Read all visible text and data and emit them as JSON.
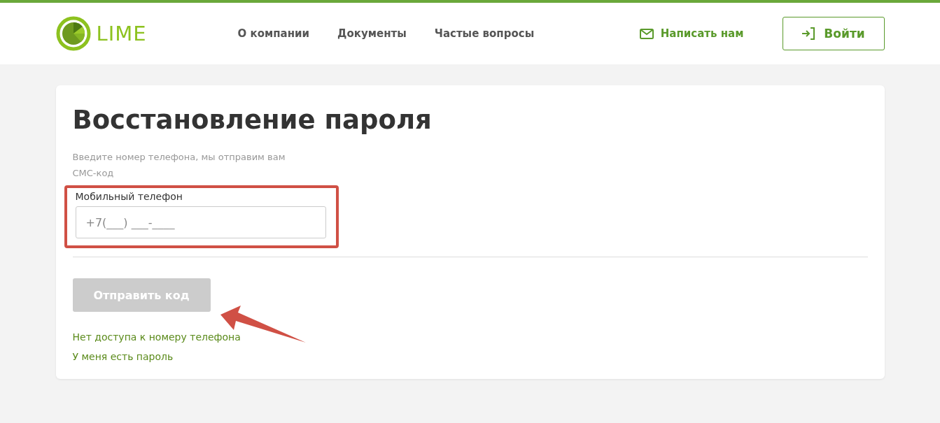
{
  "header": {
    "logo": "LIME",
    "nav": [
      "О компании",
      "Документы",
      "Частые вопросы"
    ],
    "contact_link": "Написать нам",
    "login_button": "Войти"
  },
  "card": {
    "title": "Восстановление пароля",
    "hint": "Введите номер телефона, мы отправим вам СМС-код",
    "phone_field": {
      "label": "Мобильный телефон",
      "placeholder": "+7(___) ___-____",
      "highlighted": true
    },
    "send_button": {
      "label": "Отправить код",
      "disabled": true,
      "annotated": true
    },
    "links": [
      "Нет доступа к номеру телефона",
      "У меня есть пароль"
    ]
  }
}
